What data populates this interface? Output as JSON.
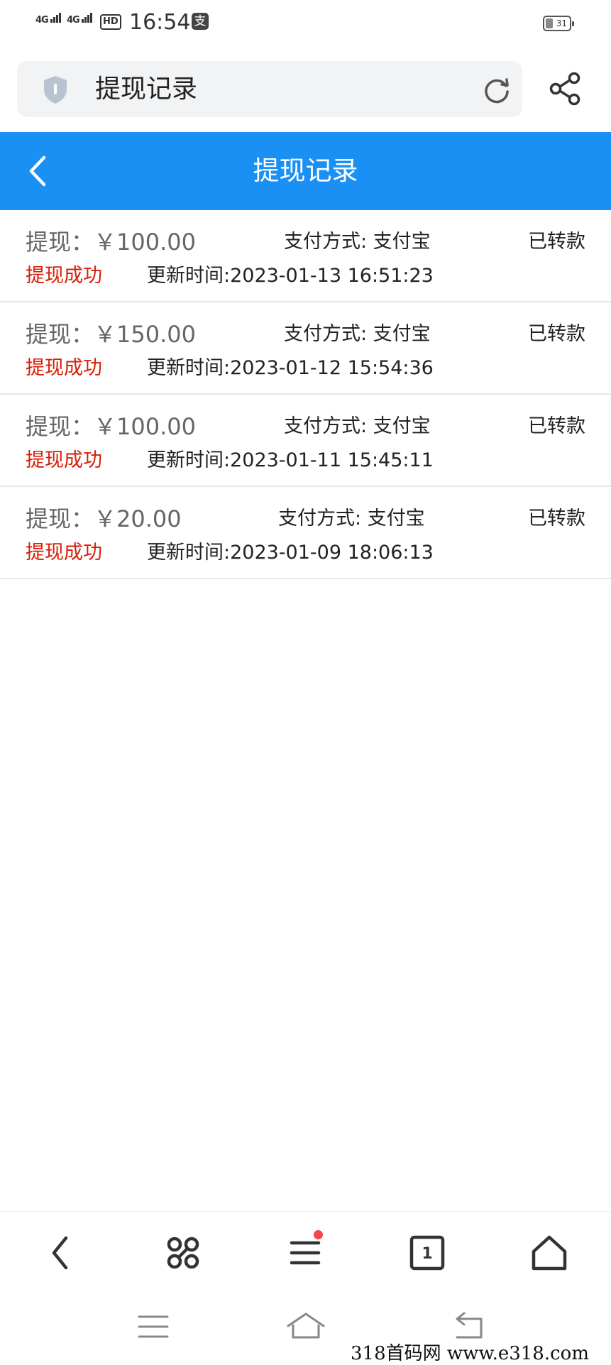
{
  "status_bar": {
    "signal1": "4G",
    "signal2": "4G",
    "hd": "HD",
    "time": "16:54",
    "pay_badge": "支",
    "battery": "31"
  },
  "browser": {
    "url_title": "提现记录",
    "icons": [
      "shield-icon",
      "refresh-icon",
      "share-icon"
    ]
  },
  "header": {
    "title": "提现记录"
  },
  "records": [
    {
      "amount": "提现：￥100.00",
      "method": "支付方式: 支付宝",
      "transfer": "已转款",
      "status": "提现成功",
      "time": "更新时间:2023-01-13 16:51:23"
    },
    {
      "amount": "提现：￥150.00",
      "method": "支付方式: 支付宝",
      "transfer": "已转款",
      "status": "提现成功",
      "time": "更新时间:2023-01-12 15:54:36"
    },
    {
      "amount": "提现：￥100.00",
      "method": "支付方式: 支付宝",
      "transfer": "已转款",
      "status": "提现成功",
      "time": "更新时间:2023-01-11 15:45:11"
    },
    {
      "amount": "提现：￥20.00",
      "method": "支付方式: 支付宝",
      "transfer": "已转款",
      "status": "提现成功",
      "time": "更新时间:2023-01-09 18:06:13"
    }
  ],
  "bottom_nav": {
    "tab_count": "1",
    "icons": [
      "back-icon",
      "apps-icon",
      "menu-icon",
      "tabs-icon",
      "home-icon"
    ]
  },
  "watermark": "318首码网  www.e318.com",
  "colors": {
    "header_blue": "#1a90f5",
    "status_red": "#d81e06"
  }
}
